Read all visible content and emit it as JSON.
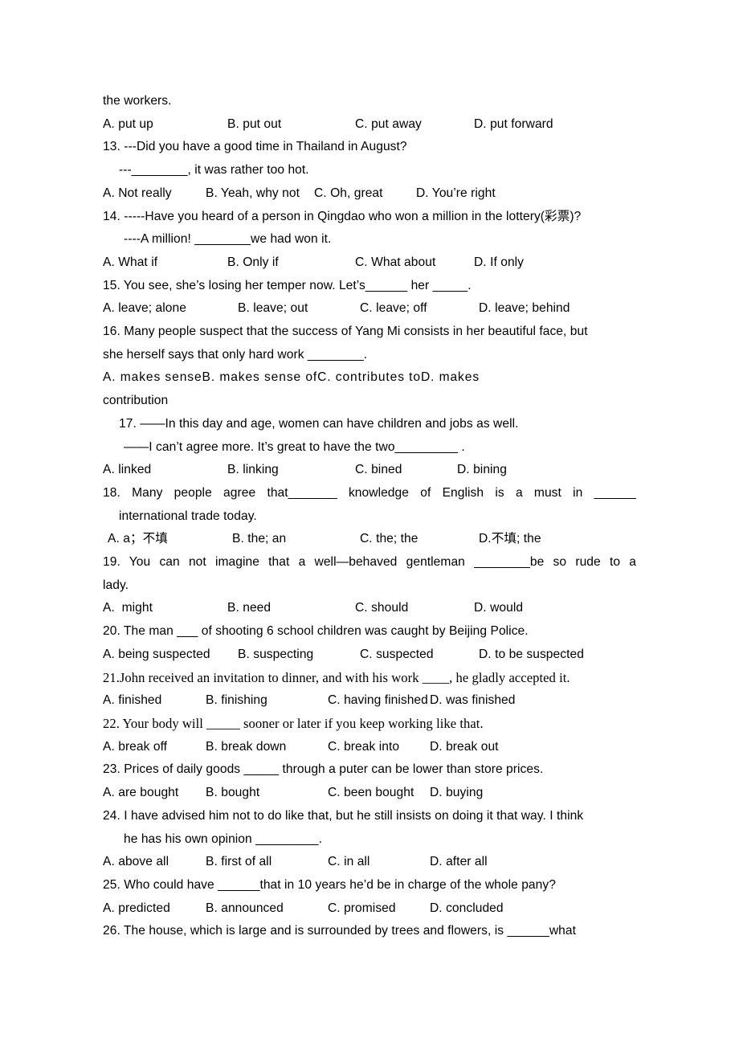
{
  "document": {
    "type": "english-grammar-multiple-choice-worksheet",
    "page_color": "#ffffff",
    "text_color": "#000000",
    "lines": {
      "carryover": "the workers.",
      "q12_options": {
        "a": "A. put up",
        "b": "B. put out",
        "c": "C. put away",
        "d": "D. put forward"
      },
      "q13": {
        "stem": "13. ---Did you have a good time in Thailand in August?",
        "stem2": "---________, it was rather too hot.",
        "a": "A. Not really",
        "b": "B. Yeah, why not",
        "c": "C. Oh, great",
        "d": "D. You’re right"
      },
      "q14": {
        "stem": "14. -----Have you heard of a person in Qingdao who won a million in the lottery(彩票)?",
        "stem2": "----A million! ________we had won it.",
        "a": "A. What if",
        "b": "B. Only if",
        "c": "C. What about",
        "d": "D. If only"
      },
      "q15": {
        "stem": "15. You see, she’s losing her temper now. Let’s______ her _____.",
        "a": "A. leave; alone",
        "b": "B. leave; out",
        "c": "C. leave; off",
        "d": "D. leave; behind"
      },
      "q16": {
        "stem": "16. Many people suspect that the success of Yang Mi consists in her beautiful face, but",
        "stem2": "she herself says that only hard work ________.",
        "a": "A. makes sense",
        "b": "B. makes sense of",
        "c": "C. contributes to",
        "d": "D. makes",
        "d_cont": "contribution"
      },
      "q17": {
        "stem": "17. ——In this day and age, women can have children and jobs as well.",
        "stem2": "——I can’t agree more. It’s great to have the two_________ .",
        "a": "A. linked",
        "b": "B. linking",
        "c": "C. bined",
        "d": "D. bining"
      },
      "q18": {
        "stem": "18. Many people agree that_______ knowledge of English is a must in ______",
        "stem2": "international trade today.",
        "a": "A. a；不填",
        "b": "B. the; an",
        "c": "C. the; the",
        "d": "D.不填; the"
      },
      "q19": {
        "stem": "19. You can not imagine that a well—behaved gentleman ________be so rude to a",
        "stem2": "lady.",
        "a": "A.  might",
        "b": "B. need",
        "c": "C. should",
        "d": "D. would"
      },
      "q20": {
        "stem": "20. The man ___ of shooting 6 school children was caught by Beijing Police.",
        "a": "A. being suspected",
        "b": "B. suspecting",
        "c": "C. suspected",
        "d": "D. to be suspected"
      },
      "q21": {
        "stem": "21.John received an invitation to dinner, and with his work ____, he gladly accepted it.",
        "a": "A. finished",
        "b": "B. finishing",
        "c": "C. having finished",
        "d": "D. was finished"
      },
      "q22": {
        "stem": "22. Your body will _____ sooner or later if you keep working like that.",
        "a": "A. break off",
        "b": "B. break down",
        "c": "C. break into",
        "d": "D. break out"
      },
      "q23": {
        "stem": "23. Prices of daily goods _____ through a puter can be lower than store prices.",
        "a": "A. are bought",
        "b": "B. bought",
        "c": "C. been bought",
        "d": "D. buying"
      },
      "q24": {
        "stem": "24. I have advised him not to do like that, but he still insists on doing it that way. I think",
        "stem2": "he has his own opinion _________.",
        "a": "A. above all",
        "b": "B. first of all",
        "c": "C. in all",
        "d": "D. after all"
      },
      "q25": {
        "stem": "25. Who could have ______that in 10 years he’d be in charge of the whole pany?",
        "a": "A. predicted",
        "b": "B. announced",
        "c": "C. promised",
        "d": "D. concluded"
      },
      "q26": {
        "stem": "26. The house, which is large and is surrounded by trees and flowers, is ______what"
      }
    }
  }
}
